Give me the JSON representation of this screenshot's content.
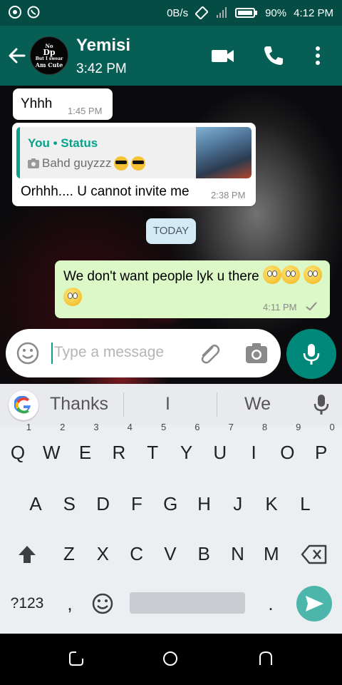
{
  "status_bar": {
    "data_speed": "0B/s",
    "battery": "90%",
    "time": "4:12 PM"
  },
  "header": {
    "contact_name": "Yemisi",
    "contact_status": "3:42 PM",
    "avatar_text": [
      "No",
      "Dp",
      "But I swear",
      "Am Cute"
    ]
  },
  "messages": [
    {
      "direction": "in",
      "text": "Yhhh",
      "time": "1:45 PM"
    },
    {
      "direction": "in",
      "quote": {
        "author": "You • Status",
        "text": "Bahd guyzzz"
      },
      "text": "Orhhh.... U cannot invite me",
      "time": "2:38 PM"
    },
    {
      "direction": "out",
      "text": "We don't want people lyk u there",
      "time": "4:11 PM",
      "tick": "sent"
    }
  ],
  "date_chip": "TODAY",
  "composer": {
    "placeholder": "Type a message"
  },
  "keyboard": {
    "suggestions": [
      "Thanks",
      "I",
      "We"
    ],
    "row1": [
      "Q",
      "W",
      "E",
      "R",
      "T",
      "Y",
      "U",
      "I",
      "O",
      "P"
    ],
    "row1_digits": [
      "1",
      "2",
      "3",
      "4",
      "5",
      "6",
      "7",
      "8",
      "9",
      "0"
    ],
    "row2": [
      "A",
      "S",
      "D",
      "F",
      "G",
      "H",
      "J",
      "K",
      "L"
    ],
    "row3": [
      "Z",
      "X",
      "C",
      "V",
      "B",
      "N",
      "M"
    ],
    "symbols_label": "?123",
    "comma": ",",
    "period": "."
  },
  "colors": {
    "header": "#075e54",
    "status_bar": "#054d44",
    "outgoing_bubble": "#dcf8c6",
    "accent": "#06a28b",
    "mic_button": "#00897b"
  },
  "icons": [
    "back-arrow-icon",
    "video-call-icon",
    "voice-call-icon",
    "more-vert-icon",
    "emoji-icon",
    "attach-icon",
    "camera-icon",
    "mic-icon",
    "google-icon",
    "shift-icon",
    "backspace-icon",
    "send-icon"
  ]
}
